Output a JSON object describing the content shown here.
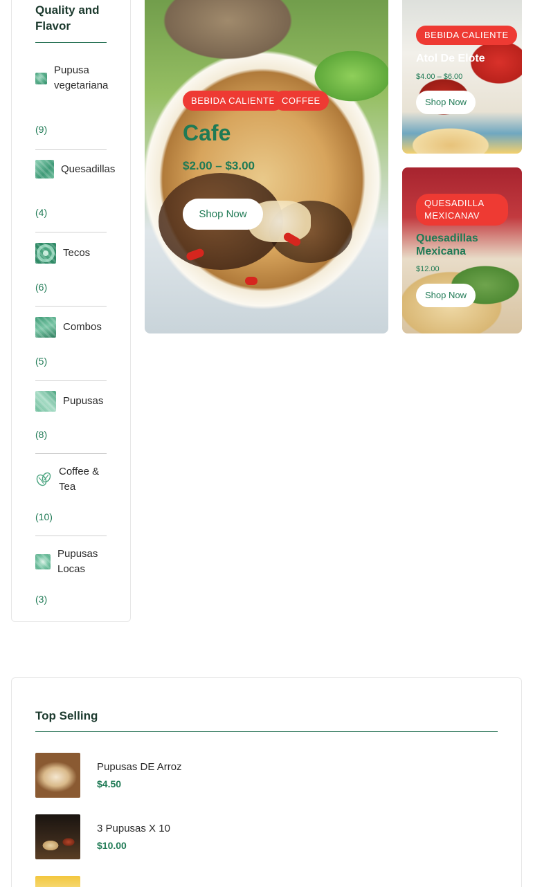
{
  "sidebar": {
    "title": "Quality and Flavor",
    "items": [
      {
        "label": "Pupusa vegetariana",
        "count": "(9)"
      },
      {
        "label": "Quesadillas",
        "count": "(4)"
      },
      {
        "label": "Tecos",
        "count": "(6)"
      },
      {
        "label": "Combos",
        "count": "(5)"
      },
      {
        "label": "Pupusas",
        "count": "(8)"
      },
      {
        "label": "Coffee & Tea",
        "count": "(10)"
      },
      {
        "label": "Pupusas Locas",
        "count": "(3)"
      }
    ]
  },
  "banners": {
    "main": {
      "tags": [
        "BEBIDA CALIENTE",
        "COFFEE"
      ],
      "title": "Cafe",
      "price": "$2.00 – $3.00",
      "button": "Shop Now"
    },
    "side1": {
      "tag": "BEBIDA CALIENTE",
      "title": "Atol De Elote",
      "price": "$4.00 – $6.00",
      "button": "Shop Now"
    },
    "side2": {
      "tag": "QUESADILLA MEXICANAV",
      "title": "Quesadillas Mexicana",
      "price": "$12.00",
      "button": "Shop Now"
    }
  },
  "top_selling": {
    "title": "Top Selling",
    "products": [
      {
        "name": "Pupusas DE Arroz",
        "price": "$4.50"
      },
      {
        "name": "3 Pupusas X 10",
        "price": "$10.00"
      }
    ]
  },
  "colors": {
    "accent_green": "#1f7a55",
    "tag_red": "#ee3a33"
  }
}
